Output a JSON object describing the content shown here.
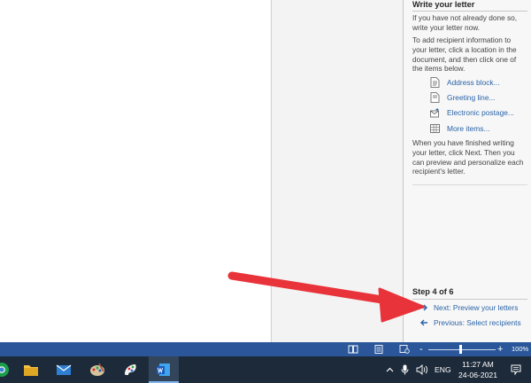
{
  "pane": {
    "heading": "Write your letter",
    "para1": "If you have not already done so, write your letter now.",
    "para2": "To add recipient information to your letter, click a location in the document, and then click one of the items below.",
    "items": [
      {
        "label": "Address block...",
        "icon": "address-block-icon"
      },
      {
        "label": "Greeting line...",
        "icon": "greeting-line-icon"
      },
      {
        "label": "Electronic postage...",
        "icon": "electronic-postage-icon"
      },
      {
        "label": "More items...",
        "icon": "more-items-icon"
      }
    ],
    "para3": "When you have finished writing your letter, click Next. Then you can preview and personalize each recipient's letter.",
    "step": "Step 4 of 6",
    "next": "Next: Preview your letters",
    "previous": "Previous: Select recipients"
  },
  "statusbar": {
    "zoom_minus": "-",
    "zoom_plus": "+",
    "zoom": "100%",
    "zoom_fraction": 0.5
  },
  "taskbar": {
    "language": "ENG",
    "time": "11:27 AM",
    "date": "24-06-2021"
  },
  "colors": {
    "link": "#2b64a8",
    "statusbar": "#2b579a",
    "taskbar": "#1d2a3a",
    "annotation_arrow": "#e8333a"
  }
}
